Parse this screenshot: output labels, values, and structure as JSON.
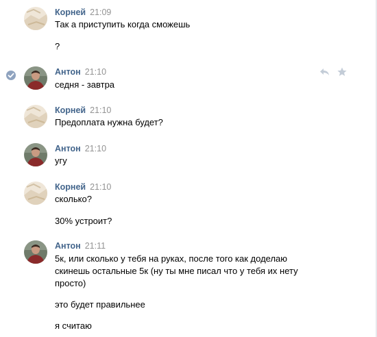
{
  "conversation": {
    "messages": [
      {
        "author": "Корней",
        "time": "21:09",
        "lines": [
          "Так а приступить когда сможешь",
          "?"
        ]
      },
      {
        "author": "Антон",
        "time": "21:10",
        "lines": [
          "седня - завтра"
        ],
        "actions": {
          "reply_icon": "reply-icon",
          "star_icon": "star-icon"
        }
      },
      {
        "author": "Корней",
        "time": "21:10",
        "lines": [
          "Предоплата нужна будет?"
        ]
      },
      {
        "author": "Антон",
        "time": "21:10",
        "lines": [
          "угу"
        ]
      },
      {
        "author": "Корней",
        "time": "21:10",
        "lines": [
          "сколько?",
          "30% устроит?"
        ]
      },
      {
        "author": "Антон",
        "time": "21:11",
        "lines": [
          "5к, или сколько у тебя на руках, после того как доделаю",
          "скинешь остальные 5к (ну ты мне писал что у тебя их нету",
          "просто)",
          "это будет правильнее",
          "я считаю"
        ]
      }
    ]
  },
  "colors": {
    "author_name": "#42648b",
    "timestamp": "#939393",
    "text": "#000000",
    "selected_check": "#8fa3bf",
    "action_icons": "#c3ccd7"
  }
}
